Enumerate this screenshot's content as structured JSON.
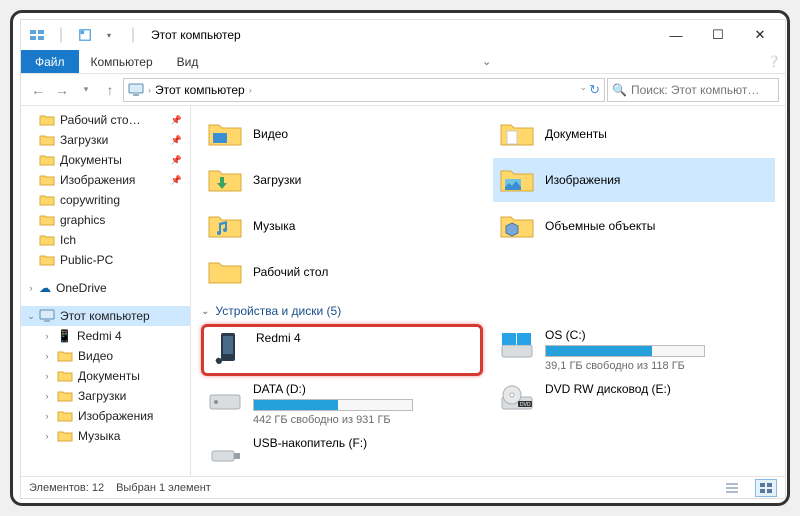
{
  "window": {
    "title": "Этот компьютер",
    "controls": {
      "min": "—",
      "max": "☐",
      "close": "✕"
    }
  },
  "menubar": {
    "file": "Файл",
    "computer": "Компьютер",
    "view": "Вид"
  },
  "navbar": {
    "crumb": "Этот компьютер",
    "search_placeholder": "Поиск: Этот компьют…",
    "refresh": "↻"
  },
  "sidebar": {
    "quick": [
      {
        "label": "Рабочий сто…",
        "pin": true
      },
      {
        "label": "Загрузки",
        "pin": true
      },
      {
        "label": "Документы",
        "pin": true
      },
      {
        "label": "Изображения",
        "pin": true
      },
      {
        "label": "copywriting",
        "pin": false
      },
      {
        "label": "graphics",
        "pin": false
      },
      {
        "label": "Ich",
        "pin": false
      },
      {
        "label": "Public-PC",
        "pin": false
      }
    ],
    "onedrive": "OneDrive",
    "thispc": "Этот компьютер",
    "thispc_children": [
      "Redmi 4",
      "Видео",
      "Документы",
      "Загрузки",
      "Изображения",
      "Музыка"
    ]
  },
  "folders": [
    {
      "label": "Видео"
    },
    {
      "label": "Документы"
    },
    {
      "label": "Загрузки"
    },
    {
      "label": "Изображения",
      "selected": true
    },
    {
      "label": "Музыка"
    },
    {
      "label": "Объемные объекты"
    },
    {
      "label": "Рабочий стол"
    }
  ],
  "group_title": "Устройства и диски (5)",
  "devices": [
    {
      "label": "Redmi 4",
      "highlight": true,
      "kind": "device"
    },
    {
      "label": "OS (C:)",
      "sub": "39,1 ГБ свободно из 118 ГБ",
      "fill": 67,
      "kind": "drive"
    },
    {
      "label": "DATA (D:)",
      "sub": "442 ГБ свободно из 931 ГБ",
      "fill": 53,
      "kind": "drive"
    },
    {
      "label": "DVD RW дисковод (E:)",
      "kind": "dvd"
    },
    {
      "label": "USB-накопитель (F:)",
      "kind": "usb"
    }
  ],
  "statusbar": {
    "count": "Элементов: 12",
    "selected": "Выбран 1 элемент"
  }
}
